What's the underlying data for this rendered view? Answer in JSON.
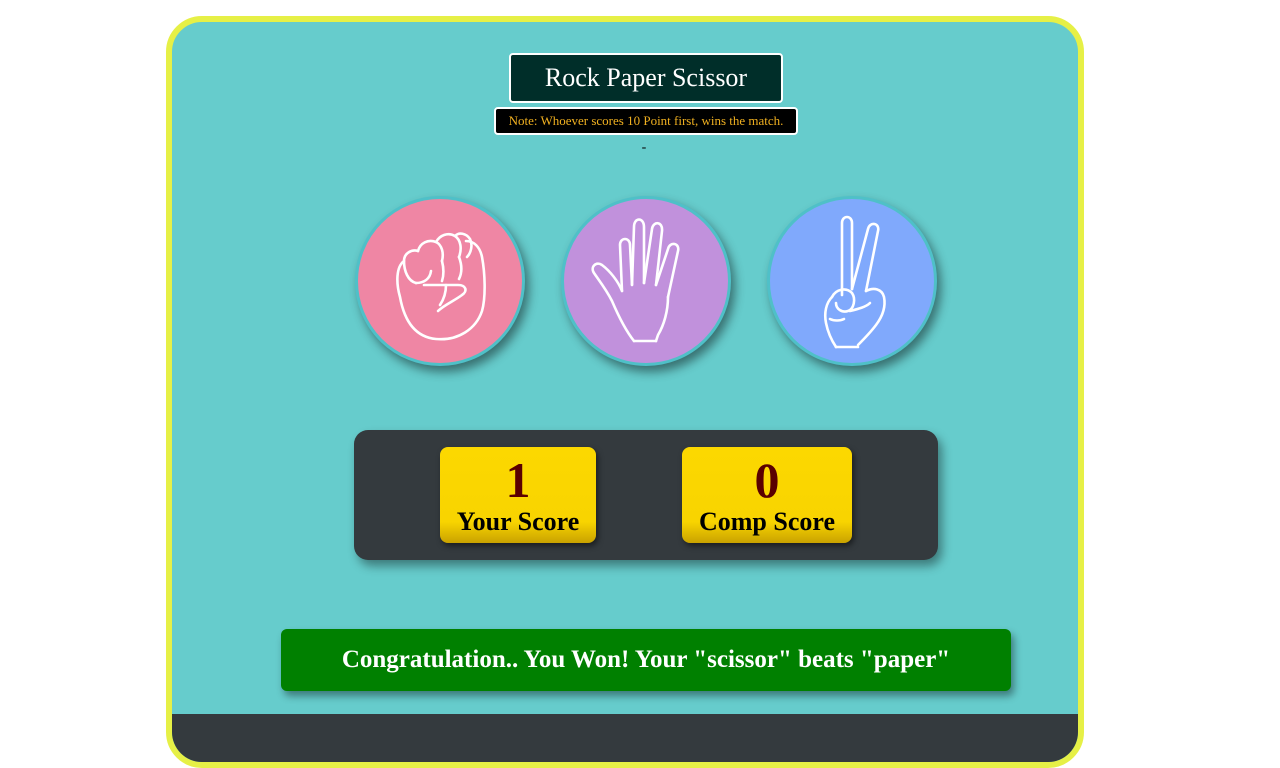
{
  "header": {
    "title": "Rock Paper Scissor",
    "note": "Note: Whoever scores 10 Point first, wins the match.",
    "separator": "-"
  },
  "choices": [
    {
      "name": "rock",
      "icon": "fist-icon",
      "color": "#ef86a4"
    },
    {
      "name": "paper",
      "icon": "open-hand-icon",
      "color": "#c191dc"
    },
    {
      "name": "scissor",
      "icon": "peace-hand-icon",
      "color": "#80a9fc"
    }
  ],
  "scores": {
    "user": {
      "value": "1",
      "label": "Your Score"
    },
    "comp": {
      "value": "0",
      "label": "Comp Score"
    }
  },
  "result": {
    "message": "Congratulation.. You Won! Your \"scissor\" beats \"paper\"",
    "color": "#008000"
  },
  "theme": {
    "background": "#66cccc",
    "border": "#e6f046",
    "panel": "#343a3e",
    "score_card": "#fcd800"
  }
}
